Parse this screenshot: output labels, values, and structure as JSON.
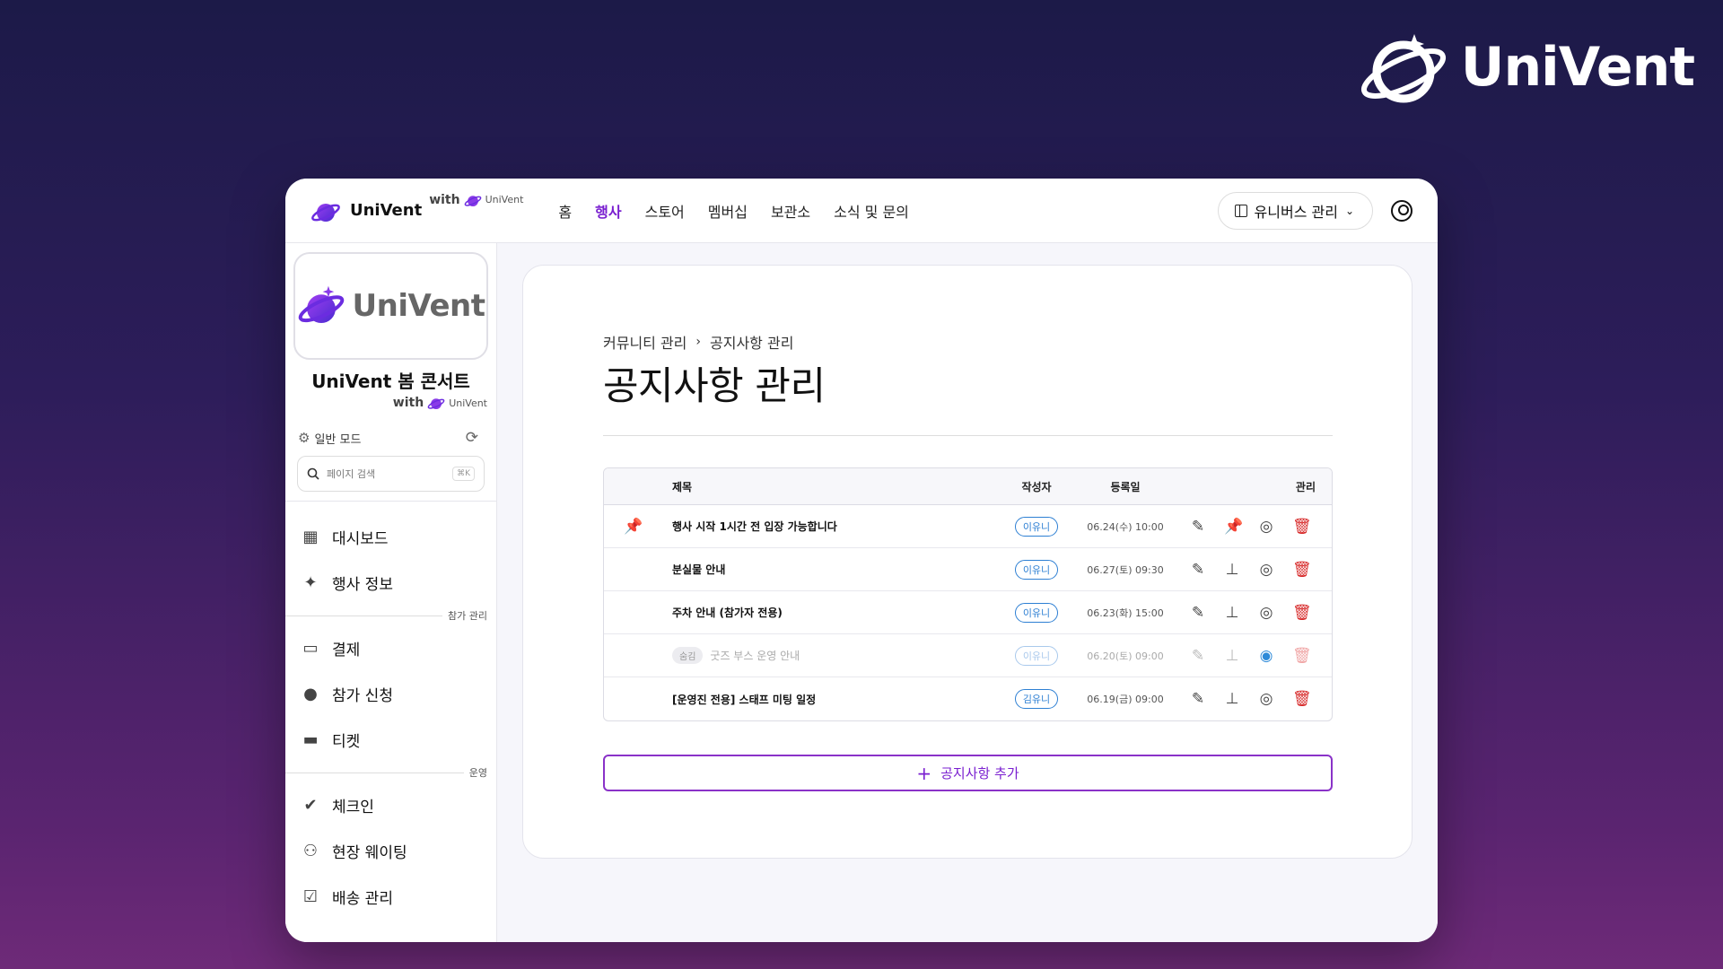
{
  "brand": {
    "name": "UniVent"
  },
  "topbar": {
    "logo_name": "UniVent",
    "with_label": "with",
    "with_brand": "UniVent",
    "nav": [
      {
        "label": "홈",
        "active": false
      },
      {
        "label": "행사",
        "active": true
      },
      {
        "label": "스토어",
        "active": false
      },
      {
        "label": "멤버십",
        "active": false
      },
      {
        "label": "보관소",
        "active": false
      },
      {
        "label": "소식 및 문의",
        "active": false
      }
    ],
    "universe_button": "유니버스 관리"
  },
  "sidebar": {
    "card_brand": "UniVent",
    "event_title": "UniVent 봄 콘서트",
    "with_label": "with",
    "with_brand": "UniVent",
    "mode_label": "일반 모드",
    "search_placeholder": "페이지 검색",
    "search_shortcut": "⌘K",
    "items": [
      {
        "label": "대시보드",
        "icon": "dashboard-icon"
      },
      {
        "label": "행사 정보",
        "icon": "party-icon"
      }
    ],
    "section1": "참가 관리",
    "items2": [
      {
        "label": "결제",
        "icon": "card-icon"
      },
      {
        "label": "참가 신청",
        "icon": "person-icon"
      },
      {
        "label": "티켓",
        "icon": "ticket-icon"
      }
    ],
    "section2": "운영",
    "items3": [
      {
        "label": "체크인",
        "icon": "check-circle-icon"
      },
      {
        "label": "현장 웨이팅",
        "icon": "people-icon"
      },
      {
        "label": "배송 관리",
        "icon": "clipboard-icon"
      }
    ]
  },
  "main": {
    "breadcrumb": [
      "커뮤니티 관리",
      "공지사항 관리"
    ],
    "title": "공지사항 관리",
    "columns": {
      "title": "제목",
      "author": "작성자",
      "date": "등록일",
      "actions": "관리"
    },
    "rows": [
      {
        "pinned": true,
        "hidden": false,
        "tag": "",
        "title": "행사 시작 1시간 전 입장 가능합니다",
        "author": "이유니",
        "date": "06.24(수) 10:00"
      },
      {
        "pinned": false,
        "hidden": false,
        "tag": "",
        "title": "분실물 안내",
        "author": "이유니",
        "date": "06.27(토) 09:30"
      },
      {
        "pinned": false,
        "hidden": false,
        "tag": "",
        "title": "주차 안내 (참가자 전용)",
        "author": "이유니",
        "date": "06.23(화) 15:00"
      },
      {
        "pinned": false,
        "hidden": true,
        "tag": "숨김",
        "title": "굿즈 부스 운영 안내",
        "author": "이유니",
        "date": "06.20(토) 09:00"
      },
      {
        "pinned": false,
        "hidden": false,
        "tag": "",
        "title": "[운영진 전용] 스태프 미팅 일정",
        "author": "김유니",
        "date": "06.19(금) 09:00"
      }
    ],
    "add_button": "공지사항 추가"
  },
  "colors": {
    "accent": "#7a1fd0",
    "danger": "#d72a2a",
    "chip": "#2d7fd3"
  }
}
